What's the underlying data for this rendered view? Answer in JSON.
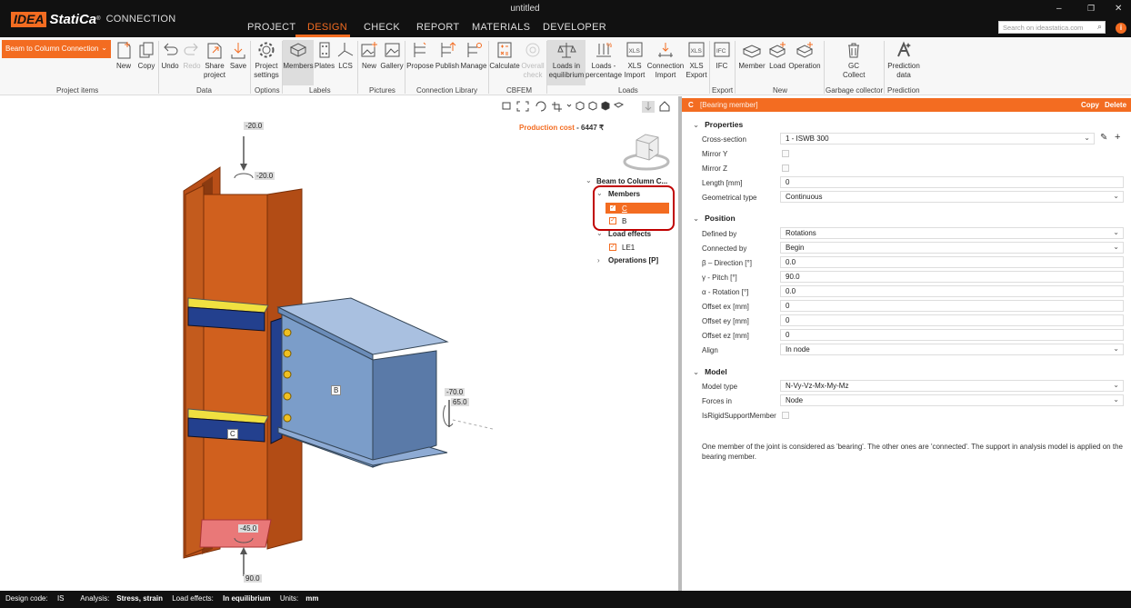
{
  "window": {
    "title": "untitled",
    "logo": {
      "idea": "IDEA",
      "statica": "StatiCa",
      "reg": "®",
      "product": "CONNECTION"
    },
    "tabs": [
      "PROJECT",
      "DESIGN",
      "CHECK",
      "REPORT",
      "MATERIALS",
      "DEVELOPER"
    ],
    "active_tab": "DESIGN",
    "search_placeholder": "Search on ideastatica.com",
    "controls": {
      "min": "–",
      "restore": "❐",
      "close": "✕"
    },
    "info": "i"
  },
  "ribbon": {
    "project_selector": "Beam to Column Connection",
    "buttons": {
      "new": "New",
      "copy": "Copy",
      "undo": "Undo",
      "redo": "Redo",
      "share": "Share project",
      "save": "Save",
      "settings": "Project settings",
      "members": "Members",
      "plates": "Plates",
      "lcs": "LCS",
      "pic_new": "New",
      "gallery": "Gallery",
      "propose": "Propose",
      "publish": "Publish",
      "manage": "Manage",
      "calculate": "Calculate",
      "overall": "Overall check",
      "equilibrium": "Loads in equilibrium",
      "percentage": "Loads - percentage",
      "xls_import": "XLS Import",
      "conn_import": "Connection Import",
      "xls_export": "XLS Export",
      "ifc": "IFC",
      "member": "Member",
      "load": "Load",
      "operation": "Operation",
      "gc": "GC Collect",
      "prediction": "Prediction data"
    },
    "groups": [
      "Project items",
      "Data",
      "Options",
      "Labels",
      "Pictures",
      "Connection Library",
      "CBFEM",
      "Loads",
      "Export",
      "New",
      "Garbage collector",
      "Prediction"
    ]
  },
  "viewport": {
    "production_cost_label": "Production cost",
    "production_cost_value": "6447 ₹",
    "tree": {
      "root": "Beam to Column C...",
      "members": "Members",
      "member_c": "C",
      "member_b": "B",
      "load_effects": "Load effects",
      "le1": "LE1",
      "operations": "Operations [P]"
    },
    "labels_3d": [
      "-20.0",
      "-20.0",
      "-70.0",
      "65.0",
      "-45.0",
      "90.0",
      "B",
      "C"
    ]
  },
  "panel": {
    "header_code": "C",
    "header_sub": "[Bearing member]",
    "copy": "Copy",
    "delete": "Delete",
    "sections": {
      "properties": "Properties",
      "position": "Position",
      "model": "Model"
    },
    "fields": {
      "cross_section": {
        "label": "Cross-section",
        "value": "1 - ISWB 300"
      },
      "mirror_y": {
        "label": "Mirror Y"
      },
      "mirror_z": {
        "label": "Mirror Z"
      },
      "length": {
        "label": "Length [mm]",
        "value": "0"
      },
      "geom_type": {
        "label": "Geometrical type",
        "value": "Continuous"
      },
      "defined_by": {
        "label": "Defined by",
        "value": "Rotations"
      },
      "connected_by": {
        "label": "Connected by",
        "value": "Begin"
      },
      "beta": {
        "label": "β – Direction [°]",
        "value": "0.0"
      },
      "gamma": {
        "label": "γ - Pitch [°]",
        "value": "90.0"
      },
      "alpha": {
        "label": "α - Rotation [°]",
        "value": "0.0"
      },
      "offset_ex": {
        "label": "Offset ex [mm]",
        "value": "0"
      },
      "offset_ey": {
        "label": "Offset ey [mm]",
        "value": "0"
      },
      "offset_ez": {
        "label": "Offset ez [mm]",
        "value": "0"
      },
      "align": {
        "label": "Align",
        "value": "In node"
      },
      "model_type": {
        "label": "Model type",
        "value": "N-Vy-Vz-Mx-My-Mz"
      },
      "forces_in": {
        "label": "Forces in",
        "value": "Node"
      },
      "rigid": {
        "label": "IsRigidSupportMember"
      }
    },
    "note": "One member of the joint is considered as 'bearing'. The other ones are 'connected'. The support in analysis model is applied on the bearing member."
  },
  "status": {
    "design_code_label": "Design code:",
    "design_code": "IS",
    "analysis_label": "Analysis:",
    "analysis": "Stress, strain",
    "load_effects_label": "Load effects:",
    "load_effects": "In equilibrium",
    "units_label": "Units:",
    "units": "mm"
  },
  "colors": {
    "accent": "#f36c21",
    "column": "#c8571b",
    "beam": "#7a9cc8",
    "highlight": "#c00000"
  }
}
